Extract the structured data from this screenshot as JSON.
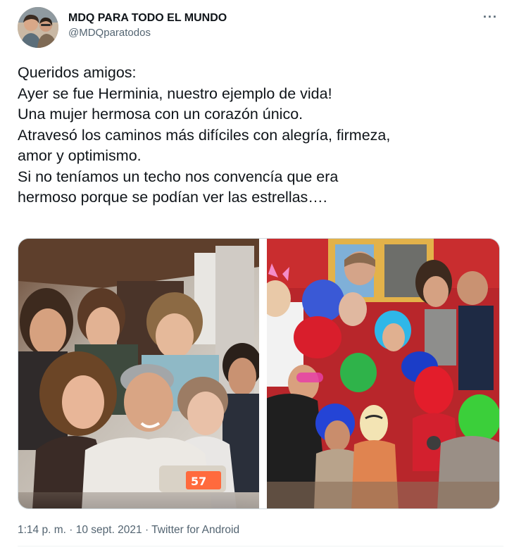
{
  "author": {
    "display_name": "MDQ PARA TODO EL MUNDO",
    "handle": "@MDQparatodos",
    "avatar_icon": "avatar-photo"
  },
  "menu": {
    "more_label": "···"
  },
  "tweet": {
    "lines": [
      "Queridos amigos:",
      "Ayer se fue Herminia, nuestro ejemplo de vida!",
      "Una mujer hermosa con un corazón único.",
      "Atravesó los caminos más difíciles con alegría, firmeza,",
      "amor y optimismo.",
      "Si no teníamos un techo nos convencía que era",
      "hermoso porque se podían ver las estrellas…."
    ]
  },
  "meta": {
    "time": "1:14 p. m.",
    "separator": " · ",
    "date": "10 sept. 2021",
    "source": "Twitter for Android"
  },
  "colors": {
    "text": "#0f1419",
    "secondary": "#536471",
    "border": "#cfd9de"
  }
}
